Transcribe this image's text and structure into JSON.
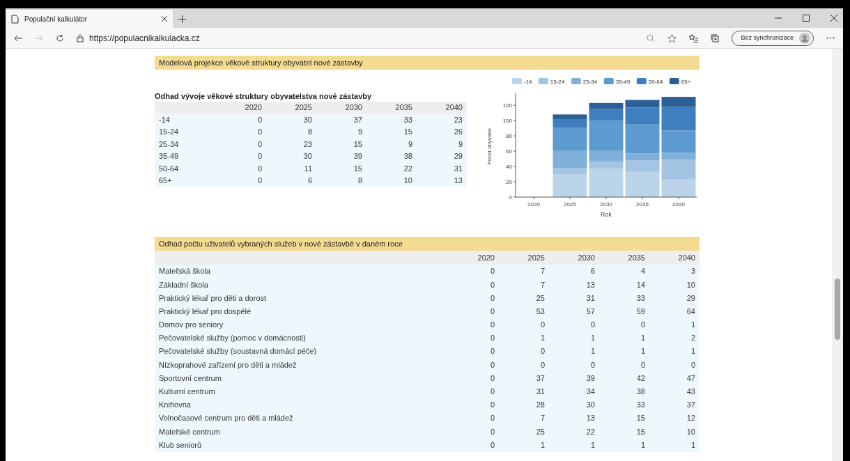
{
  "browser": {
    "tab_title": "Populační kalkulátor",
    "url": "https://populacnikalkulacka.cz",
    "sync_label": "Bez synchronizace"
  },
  "section_1": {
    "title": "Modelová projekce věkové struktury obyvatel nové zástavby",
    "table": {
      "title": "Odhad vývoje věkové struktury obyvatelstva nové zástavby",
      "columns": [
        "2020",
        "2025",
        "2030",
        "2035",
        "2040"
      ],
      "rows": [
        {
          "label": "-14",
          "values": [
            "0",
            "30",
            "37",
            "33",
            "23"
          ]
        },
        {
          "label": "15-24",
          "values": [
            "0",
            "8",
            "9",
            "15",
            "26"
          ]
        },
        {
          "label": "25-34",
          "values": [
            "0",
            "23",
            "15",
            "9",
            "9"
          ]
        },
        {
          "label": "35-49",
          "values": [
            "0",
            "30",
            "39",
            "38",
            "29"
          ]
        },
        {
          "label": "50-64",
          "values": [
            "0",
            "11",
            "15",
            "22",
            "31"
          ]
        },
        {
          "label": "65+",
          "values": [
            "0",
            "6",
            "8",
            "10",
            "13"
          ]
        }
      ]
    },
    "chart_data": {
      "type": "bar",
      "stacked": true,
      "legend": true,
      "xlabel": "Rok",
      "ylabel": "Počet obyvatel",
      "categories": [
        "2020",
        "2025",
        "2030",
        "2035",
        "2040"
      ],
      "ylim": [
        0,
        132
      ],
      "yticks": [
        0,
        20,
        40,
        60,
        80,
        100,
        120
      ],
      "series": [
        {
          "name": "-14",
          "color": "#bcd4ea",
          "values": [
            0,
            30,
            37,
            33,
            23
          ]
        },
        {
          "name": "15-24",
          "color": "#a3c4e3",
          "values": [
            0,
            8,
            9,
            15,
            26
          ]
        },
        {
          "name": "25-34",
          "color": "#7fb0da",
          "values": [
            0,
            23,
            15,
            9,
            9
          ]
        },
        {
          "name": "35-49",
          "color": "#5d9acf",
          "values": [
            0,
            30,
            39,
            38,
            29
          ]
        },
        {
          "name": "50-64",
          "color": "#3f7fc0",
          "values": [
            0,
            11,
            15,
            22,
            31
          ]
        },
        {
          "name": "65+",
          "color": "#2b5f96",
          "values": [
            0,
            6,
            8,
            10,
            13
          ]
        }
      ]
    }
  },
  "section_2": {
    "title": "Odhad počtu uživatelů vybraných služeb v nové zástavbě v daném roce",
    "table": {
      "columns": [
        "2020",
        "2025",
        "2030",
        "2035",
        "2040"
      ],
      "rows": [
        {
          "label": "Mateřská škola",
          "values": [
            "0",
            "7",
            "6",
            "4",
            "3"
          ]
        },
        {
          "label": "Základní škola",
          "values": [
            "0",
            "7",
            "13",
            "14",
            "10"
          ]
        },
        {
          "label": "Praktický lékař pro děti a dorost",
          "values": [
            "0",
            "25",
            "31",
            "33",
            "29"
          ]
        },
        {
          "label": "Praktický lékař pro dospělé",
          "values": [
            "0",
            "53",
            "57",
            "59",
            "64"
          ]
        },
        {
          "label": "Domov pro seniory",
          "values": [
            "0",
            "0",
            "0",
            "0",
            "1"
          ]
        },
        {
          "label": "Pečovatelské služby (pomoc v domácnosti)",
          "values": [
            "0",
            "1",
            "1",
            "1",
            "2"
          ]
        },
        {
          "label": "Pečovatelské služby (soustavná domácí péče)",
          "values": [
            "0",
            "0",
            "1",
            "1",
            "1"
          ]
        },
        {
          "label": "Nízkoprahové zařízení pro děti a mládež",
          "values": [
            "0",
            "0",
            "0",
            "0",
            "0"
          ]
        },
        {
          "label": "Sportovní centrum",
          "values": [
            "0",
            "37",
            "39",
            "42",
            "47"
          ]
        },
        {
          "label": "Kulturní centrum",
          "values": [
            "0",
            "31",
            "34",
            "38",
            "43"
          ]
        },
        {
          "label": "Knihovna",
          "values": [
            "0",
            "28",
            "30",
            "33",
            "37"
          ]
        },
        {
          "label": "Volnočasové centrum pro děti a mládež",
          "values": [
            "0",
            "7",
            "13",
            "15",
            "12"
          ]
        },
        {
          "label": "Mateřské centrum",
          "values": [
            "0",
            "25",
            "22",
            "15",
            "10"
          ]
        },
        {
          "label": "Klub seniorů",
          "values": [
            "0",
            "1",
            "1",
            "1",
            "1"
          ]
        }
      ]
    }
  }
}
